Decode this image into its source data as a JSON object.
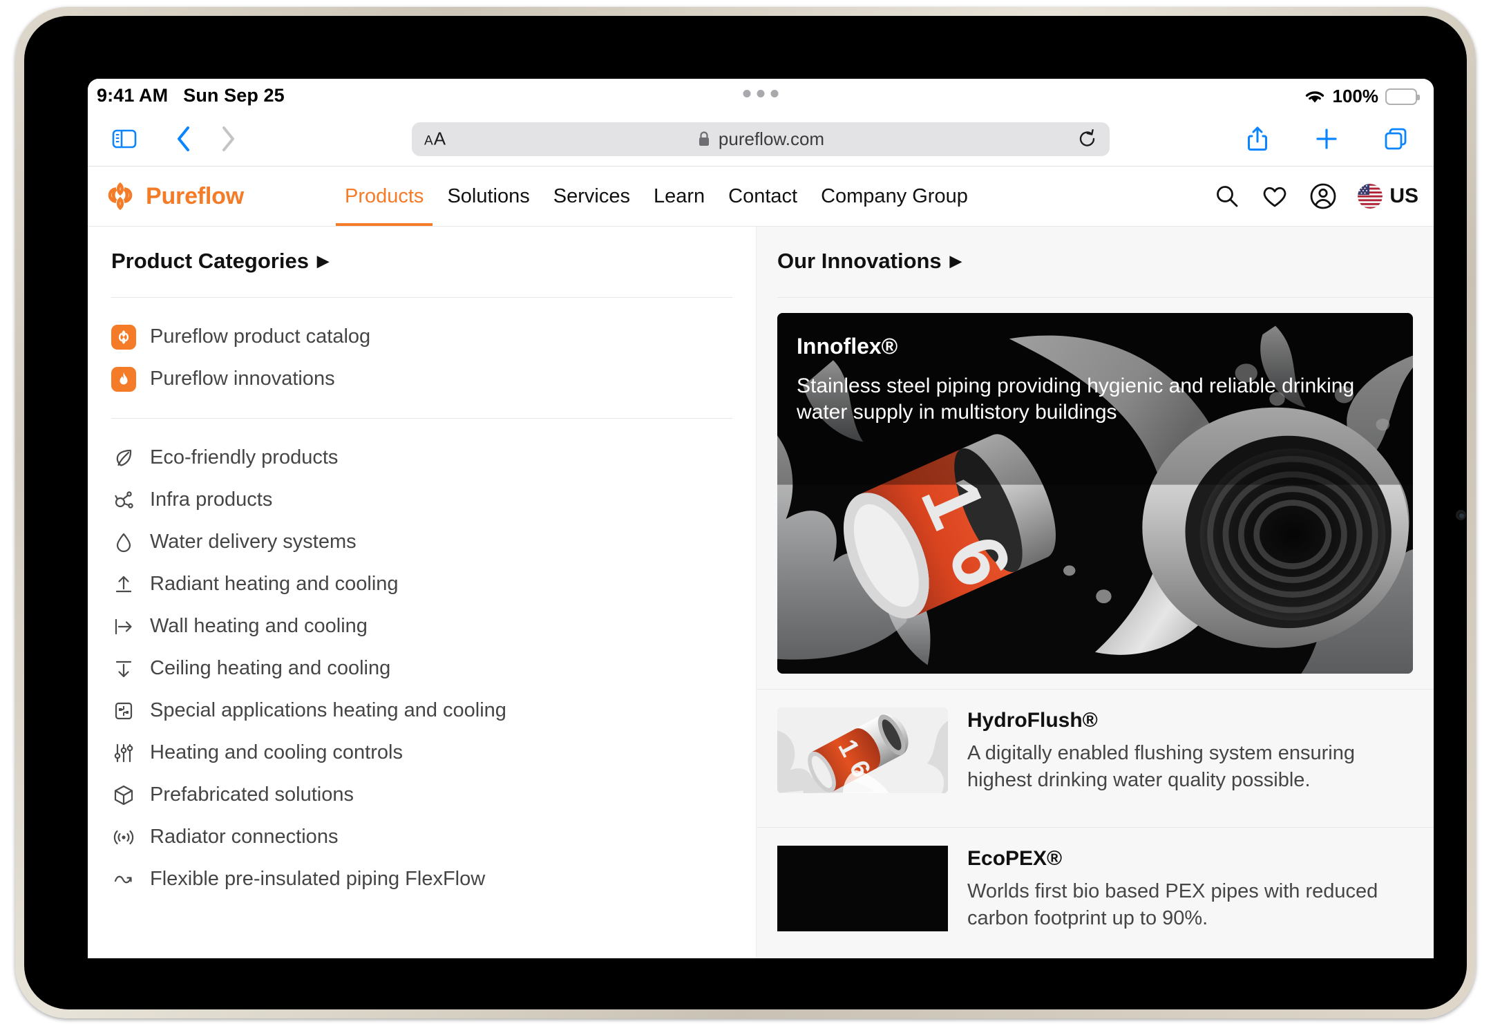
{
  "status_bar": {
    "time": "9:41 AM",
    "date": "Sun Sep 25",
    "battery_percent": "100%",
    "wifi_icon": "wifi-icon",
    "battery_icon": "battery-icon"
  },
  "browser": {
    "sidebar_icon": "sidebar-icon",
    "back_icon": "chevron-left-icon",
    "forward_icon": "chevron-right-icon",
    "aa_small": "A",
    "aa_big": "A",
    "lock_icon": "lock-icon",
    "url": "pureflow.com",
    "reload_icon": "reload-icon",
    "share_icon": "share-icon",
    "new_tab_icon": "plus-icon",
    "tabs_icon": "tabs-icon"
  },
  "site": {
    "brand": "Pureflow",
    "brand_color": "#F47B28",
    "nav": [
      {
        "label": "Products",
        "active": true
      },
      {
        "label": "Solutions",
        "active": false
      },
      {
        "label": "Services",
        "active": false
      },
      {
        "label": "Learn",
        "active": false
      },
      {
        "label": "Contact",
        "active": false
      },
      {
        "label": "Company Group",
        "active": false
      }
    ],
    "actions": {
      "search_icon": "search-icon",
      "wishlist_icon": "heart-icon",
      "account_icon": "account-circle-icon",
      "flag_icon": "us-flag-icon",
      "locale": "US"
    }
  },
  "megamenu": {
    "left": {
      "title": "Product Categories",
      "caret": "▶",
      "featured": [
        {
          "label": "Pureflow product catalog",
          "icon": "pureflow-knot-icon"
        },
        {
          "label": "Pureflow innovations",
          "icon": "flame-icon"
        }
      ],
      "categories": [
        {
          "label": "Eco-friendly products",
          "icon": "leaf-icon"
        },
        {
          "label": "Infra products",
          "icon": "network-nodes-icon"
        },
        {
          "label": "Water delivery systems",
          "icon": "water-drop-icon"
        },
        {
          "label": "Radiant heating and cooling",
          "icon": "arrow-up-from-line-icon"
        },
        {
          "label": "Wall heating and cooling",
          "icon": "arrow-right-from-line-icon"
        },
        {
          "label": "Ceiling heating and cooling",
          "icon": "arrow-down-from-line-icon"
        },
        {
          "label": "Special applications heating and cooling",
          "icon": "puzzle-square-icon"
        },
        {
          "label": "Heating and cooling controls",
          "icon": "sliders-icon"
        },
        {
          "label": "Prefabricated solutions",
          "icon": "box-3d-icon"
        },
        {
          "label": "Radiator connections",
          "icon": "broadcast-icon"
        },
        {
          "label": "Flexible pre-insulated piping FlexFlow",
          "icon": "wave-arrow-icon"
        }
      ]
    },
    "right": {
      "title": "Our Innovations",
      "caret": "▶",
      "hero": {
        "title": "Innoflex®",
        "description": "Stainless steel piping providing hygienic and reliable drinking water supply in multistory buildings",
        "image": "pipe-fitting-water-splash-dark"
      },
      "items": [
        {
          "title": "HydroFlush®",
          "description": "A digitally enabled flushing system ensuring highest drinking water quality possible.",
          "image": "pipe-fitting-ice-light"
        },
        {
          "title": "EcoPEX®",
          "description": "Worlds first bio based PEX pipes with reduced carbon footprint up to 90%.",
          "image": "dark-placeholder"
        }
      ]
    }
  }
}
